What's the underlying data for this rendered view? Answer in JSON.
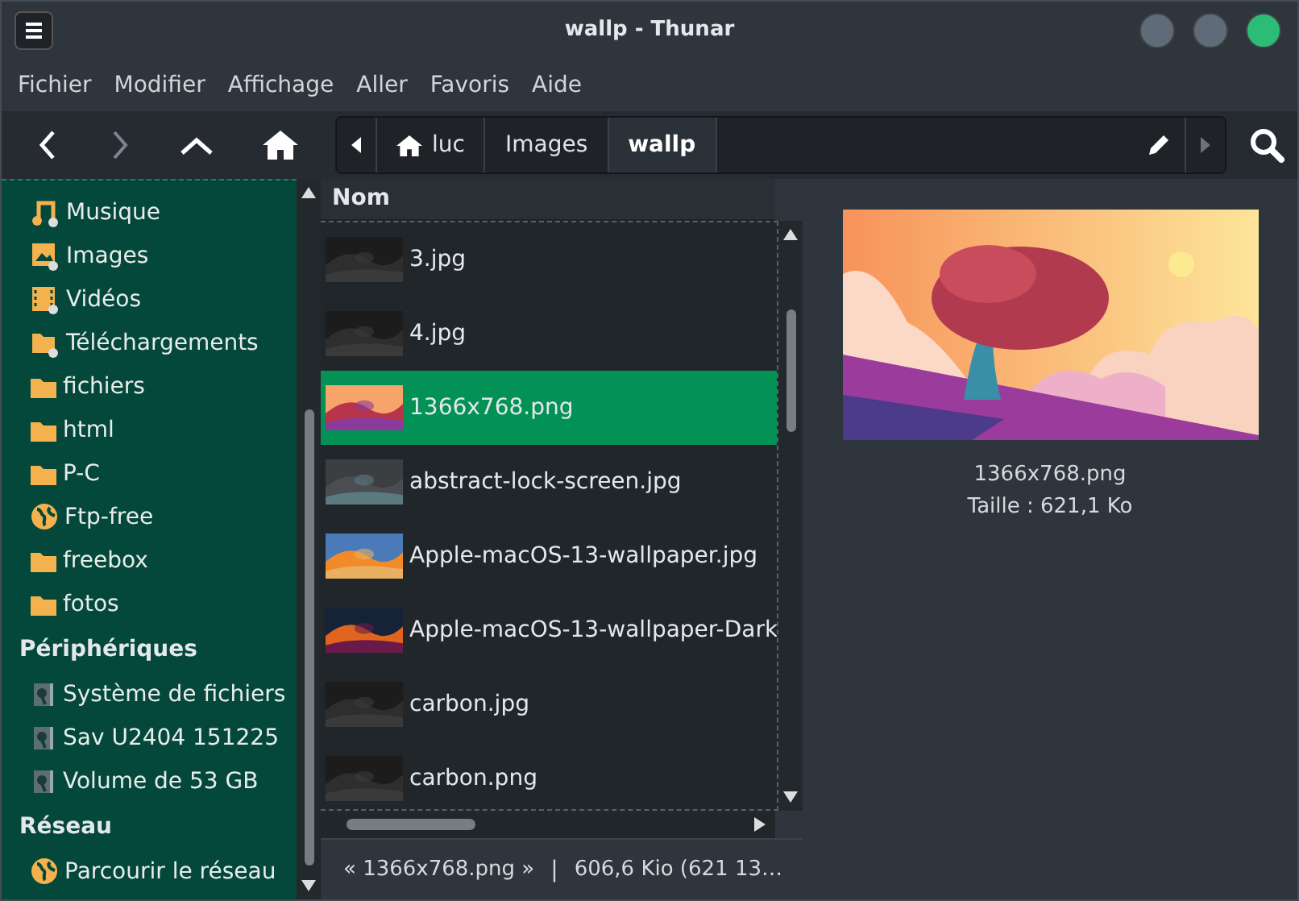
{
  "window": {
    "title": "wallp - Thunar"
  },
  "menu": [
    "Fichier",
    "Modifier",
    "Affichage",
    "Aller",
    "Favoris",
    "Aide"
  ],
  "path": [
    {
      "label": "luc",
      "home": true,
      "selected": false
    },
    {
      "label": "Images",
      "home": false,
      "selected": false
    },
    {
      "label": "wallp",
      "home": false,
      "selected": true
    }
  ],
  "sidebar": {
    "places": [
      {
        "label": "Musique",
        "kind": "music"
      },
      {
        "label": "Images",
        "kind": "images"
      },
      {
        "label": "Vidéos",
        "kind": "videos"
      },
      {
        "label": "Téléchargements",
        "kind": "downloads"
      },
      {
        "label": "fichiers",
        "kind": "folder"
      },
      {
        "label": "html",
        "kind": "folder"
      },
      {
        "label": "P-C",
        "kind": "folder"
      },
      {
        "label": "Ftp-free",
        "kind": "network"
      },
      {
        "label": "freebox",
        "kind": "folder"
      },
      {
        "label": "fotos",
        "kind": "folder"
      }
    ],
    "devices_heading": "Périphériques",
    "devices": [
      {
        "label": "Système de fichiers",
        "kind": "drive"
      },
      {
        "label": "Sav U2404 151225",
        "kind": "drive"
      },
      {
        "label": "Volume de 53 GB",
        "kind": "drive"
      }
    ],
    "network_heading": "Réseau",
    "network": [
      {
        "label": "Parcourir le réseau",
        "kind": "network"
      }
    ]
  },
  "files": {
    "column": "Nom",
    "rows": [
      {
        "name": "3.jpg",
        "selected": false
      },
      {
        "name": "4.jpg",
        "selected": false
      },
      {
        "name": "1366x768.png",
        "selected": true
      },
      {
        "name": "abstract-lock-screen.jpg",
        "selected": false
      },
      {
        "name": "Apple-macOS-13-wallpaper.jpg",
        "selected": false
      },
      {
        "name": "Apple-macOS-13-wallpaper-Dark",
        "selected": false
      },
      {
        "name": "carbon.jpg",
        "selected": false
      },
      {
        "name": "carbon.png",
        "selected": false
      }
    ]
  },
  "preview": {
    "name": "1366x768.png",
    "size": "Taille : 621,1 Ko"
  },
  "status_bar": {
    "name": "« 1366x768.png »",
    "separator": "|",
    "size": "606,6 Kio (621 13…"
  }
}
